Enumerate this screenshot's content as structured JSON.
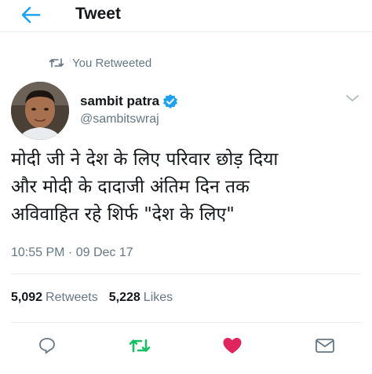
{
  "header": {
    "title": "Tweet",
    "back_icon": "arrow-left-icon"
  },
  "retweet_context": {
    "label": "You Retweeted",
    "icon": "retweet-icon"
  },
  "author": {
    "name": "sambit patra",
    "handle": "@sambitswraj",
    "verified": true,
    "verified_icon": "verified-badge-icon"
  },
  "tweet": {
    "lines": [
      "मोदी जी ने देश के लिए परिवार छोड़ दिया",
      "और मोदी के दादाजी अंतिम दिन तक",
      "अविवाहित रहे शिर्फ \"देश के लिए\""
    ],
    "timestamp": "10:55 PM · 09 Dec 17"
  },
  "stats": {
    "retweets_count": "5,092",
    "retweets_label": "Retweets",
    "likes_count": "5,228",
    "likes_label": "Likes"
  },
  "actions": {
    "reply_icon": "reply-icon",
    "retweet_icon": "retweet-icon",
    "like_icon": "heart-icon",
    "message_icon": "envelope-icon"
  },
  "colors": {
    "accent": "#1da1f2",
    "retweet_active": "#17bf63",
    "like_active": "#e0245e",
    "secondary_text": "#657786"
  }
}
